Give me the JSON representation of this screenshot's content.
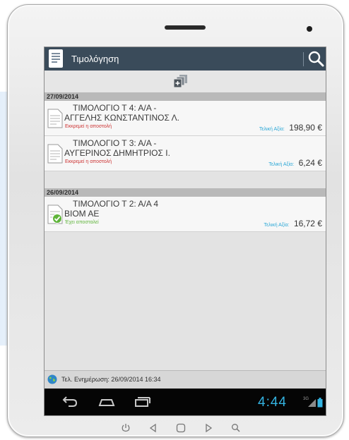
{
  "app": {
    "title": "Τιμολόγηση"
  },
  "sections": [
    {
      "date": "27/09/2014",
      "invoices": [
        {
          "line1": "ΤΙΜΟΛΟΓΙΟ  Τ 4: Α/Α -",
          "line2": "ΑΓΓΕΛΗΣ ΚΩΝΣΤΑΝΤΙΝΟΣ Λ.",
          "status": "Εκκρεμεί η αποστολή",
          "total_label": "Τελική Αξία:",
          "total_value": "198,90 €"
        },
        {
          "line1": "ΤΙΜΟΛΟΓΙΟ  Τ 3: Α/Α -",
          "line2": "ΑΥΓΕΡΙΝΟΣ ΔΗΜΗΤΡΙΟΣ Ι.",
          "status": "Εκκρεμεί η αποστολή",
          "total_label": "Τελική Αξία:",
          "total_value": "6,24 €"
        }
      ]
    },
    {
      "date": "26/09/2014",
      "invoices": [
        {
          "line1": "ΤΙΜΟΛΟΓΙΟ Τ 2: Α/Α 4",
          "line2": "ΒΙΟΜ ΑΕ",
          "status": "Έχει αποσταλεί",
          "total_label": "Τελική Αξία:",
          "total_value": "16,72 €"
        }
      ]
    }
  ],
  "footer": {
    "last_update": "Τελ. Ενημέρωση: 26/09/2014 16:34"
  },
  "system": {
    "clock": "4:44",
    "network": "3G"
  },
  "icons": {
    "app": "invoice-app-icon",
    "search": "search-icon",
    "add": "add-documents-icon",
    "document": "document-icon",
    "sent": "checkmark-icon",
    "globe": "globe-icon",
    "back": "back-icon",
    "home": "home-icon",
    "recent": "recent-apps-icon",
    "signal": "signal-icon",
    "battery": "battery-icon"
  },
  "colors": {
    "app_bar": "#3a4b5a",
    "pending": "#cc3232",
    "sent": "#5fb43a",
    "total_label": "#2aa7d6",
    "clock": "#34b4e2",
    "date_header": "#b9b9b9"
  }
}
